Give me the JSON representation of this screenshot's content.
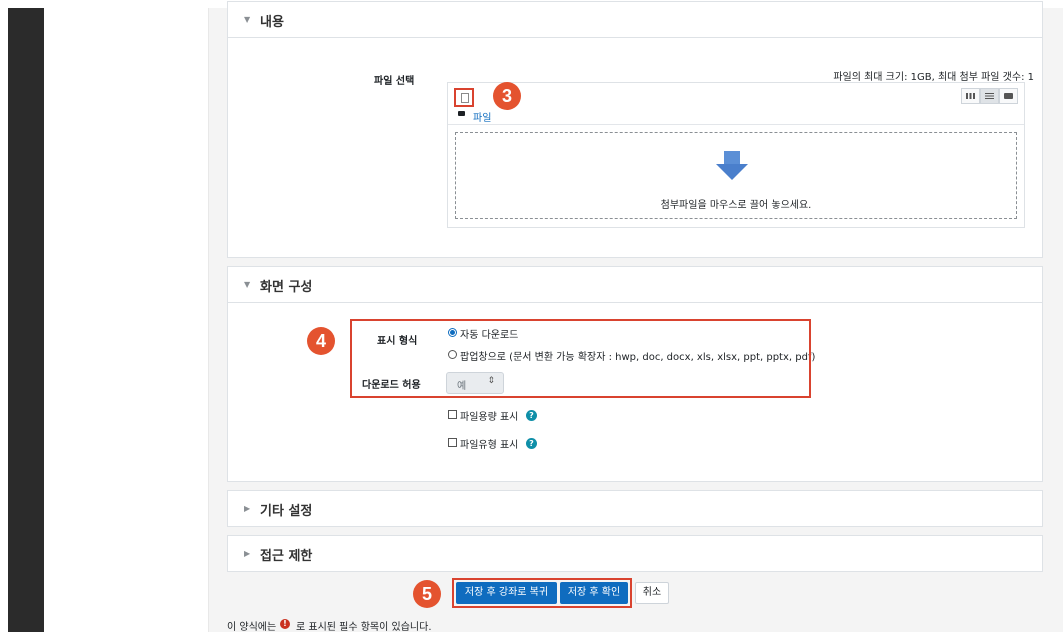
{
  "sections": {
    "content": {
      "title": "내용",
      "file_select_label": "파일 선택",
      "max_info": "파일의 최대 크기: 1GB, 최대 첨부 파일 갯수: 1",
      "path_label": "파일",
      "drop_text": "첨부파일을 마우스로 끌어 놓으세요.",
      "annotation": "3"
    },
    "display": {
      "title": "화면 구성",
      "annotation": "4",
      "display_mode_label": "표시 형식",
      "options": [
        {
          "label": "자동 다운로드",
          "selected": true
        },
        {
          "label": "팝업창으로 (문서 변환 가능 확장자 : hwp, doc, docx, xls, xlsx, ppt, pptx, pdf)",
          "selected": false
        }
      ],
      "download_label": "다운로드 허용",
      "download_value": "예",
      "checkbox_size": "파일용량 표시",
      "checkbox_type": "파일유형 표시"
    },
    "other": {
      "title": "기타 설정"
    },
    "access": {
      "title": "접근 제한"
    }
  },
  "buttons": {
    "annotation": "5",
    "save_return": "저장 후 강좌로 복귀",
    "save_view": "저장 후 확인",
    "cancel": "취소"
  },
  "footer": {
    "required_prefix": "이 양식에는",
    "required_icon": "!",
    "required_suffix": "로 표시된 필수 항목이 있습니다."
  },
  "colors": {
    "accent": "#0f6cbf",
    "annotation": "#e4532f",
    "help": "#0f8fa8"
  }
}
